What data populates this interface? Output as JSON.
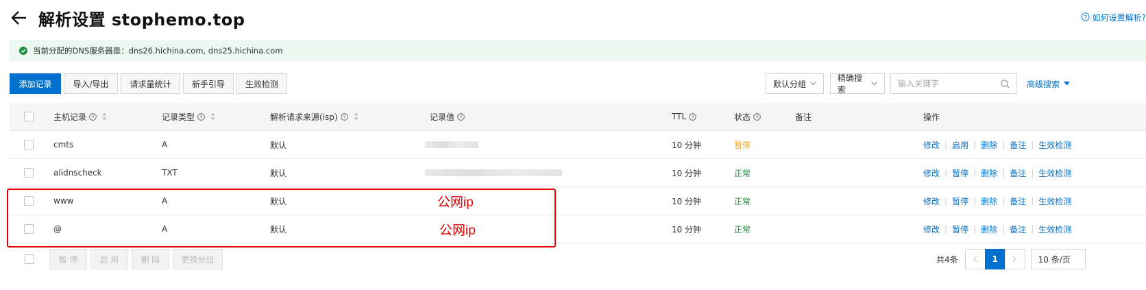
{
  "header": {
    "title": "解析设置 stophemo.top",
    "help_link": "如何设置解析?"
  },
  "notice": {
    "text": "当前分配的DNS服务器是：dns26.hichina.com, dns25.hichina.com",
    "color": "#1e8e3e"
  },
  "toolbar": {
    "add_record": "添加记录",
    "import_export": "导入/导出",
    "request_stats": "请求量统计",
    "beginner_guide": "新手引导",
    "effect_check": "生效检测",
    "group_select": "默认分组",
    "search_mode": "精确搜索",
    "search_placeholder": "输入关键字",
    "advanced_search": "高级搜索"
  },
  "table": {
    "columns": {
      "host": "主机记录",
      "type": "记录类型",
      "isp": "解析请求来源(isp)",
      "value": "记录值",
      "ttl": "TTL",
      "status": "状态",
      "remark": "备注",
      "actions": "操作"
    },
    "rows": [
      {
        "host": "cmts",
        "type": "A",
        "isp": "默认",
        "value": "",
        "ttl": "10 分钟",
        "status": "暂停",
        "toggle": "启用",
        "modify": "修改",
        "delete": "删除",
        "remark": "备注",
        "check": "生效检测"
      },
      {
        "host": "alidnscheck",
        "type": "TXT",
        "isp": "默认",
        "value": "",
        "ttl": "10 分钟",
        "status": "正常",
        "toggle": "暂停",
        "modify": "修改",
        "delete": "删除",
        "remark": "备注",
        "check": "生效检测"
      },
      {
        "host": "www",
        "type": "A",
        "isp": "默认",
        "value": "公网ip",
        "ttl": "10 分钟",
        "status": "正常",
        "toggle": "暂停",
        "modify": "修改",
        "delete": "删除",
        "remark": "备注",
        "check": "生效检测"
      },
      {
        "host": "@",
        "type": "A",
        "isp": "默认",
        "value": "公网ip",
        "ttl": "10 分钟",
        "status": "正常",
        "toggle": "暂停",
        "modify": "修改",
        "delete": "删除",
        "remark": "备注",
        "check": "生效检测"
      }
    ]
  },
  "footer": {
    "pause": "暂 停",
    "enable": "启 用",
    "delete": "删 除",
    "change_group": "更换分组",
    "total": "共4条",
    "current_page": "1",
    "page_size": "10 条/页"
  },
  "colors": {
    "accent": "#0070cc",
    "paused": "#f5a623",
    "normal": "#1e8e3e",
    "annotation": "#e60000"
  }
}
